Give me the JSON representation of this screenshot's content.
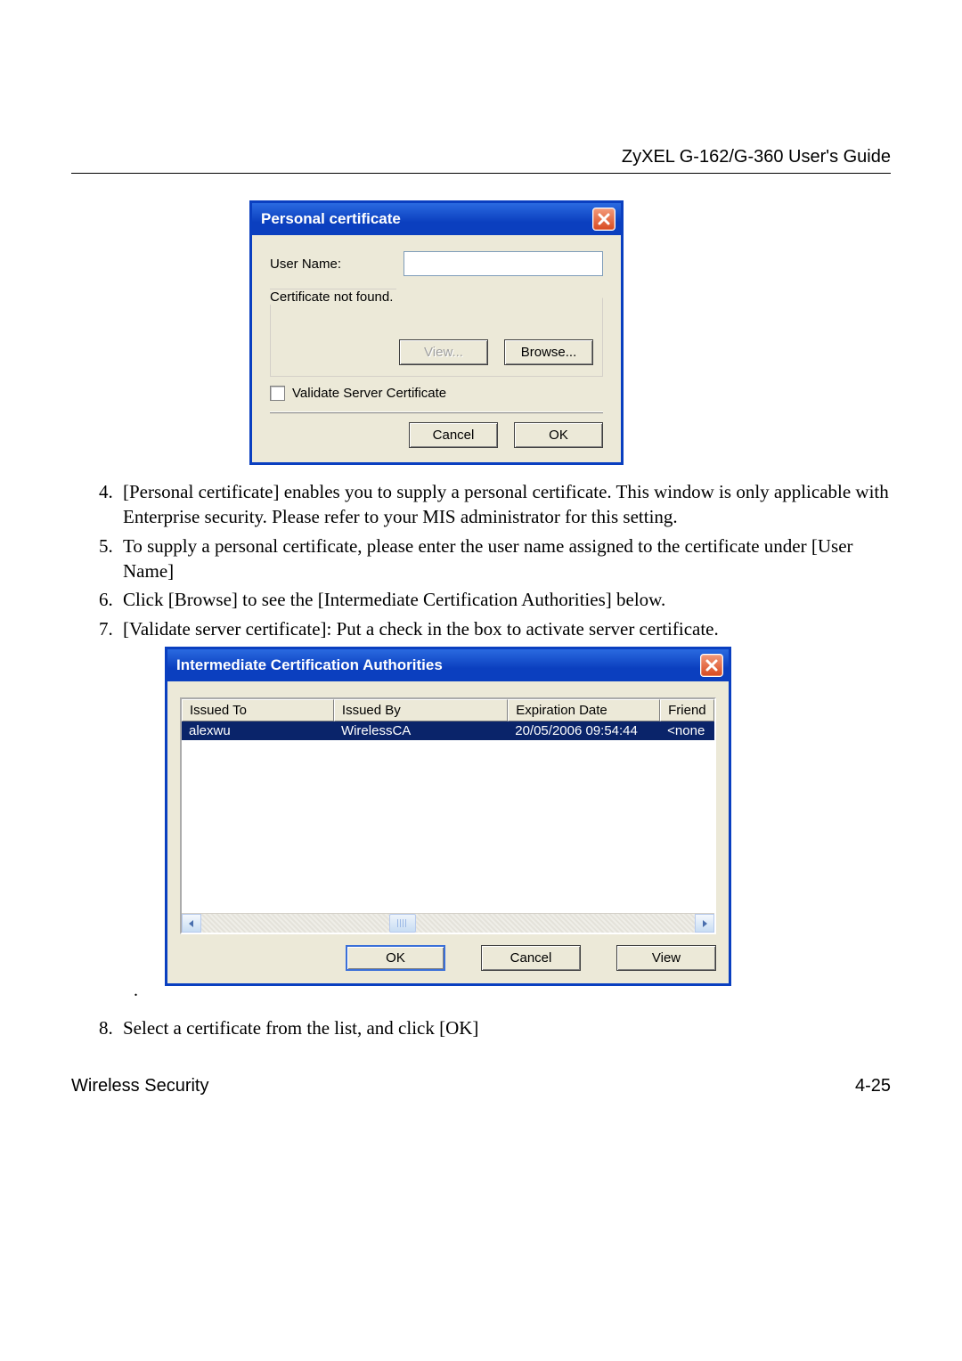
{
  "header": {
    "title": "ZyXEL G-162/G-360 User's Guide"
  },
  "dialog1": {
    "title": "Personal certificate",
    "user_name_label": "User Name:",
    "user_name_value": "",
    "group_caption": "Certificate not found.",
    "view_btn": "View...",
    "browse_btn": "Browse...",
    "validate_label": "Validate Server Certificate",
    "cancel_btn": "Cancel",
    "ok_btn": "OK"
  },
  "list": {
    "items": [
      {
        "n": "4.",
        "t": "[Personal certificate] enables you to supply a personal certificate.  This window is only applicable with Enterprise security.  Please refer to your MIS administrator for this setting."
      },
      {
        "n": "5.",
        "t": "To supply a personal certificate, please enter the user name assigned to the certificate under [User Name]"
      },
      {
        "n": "6.",
        "t": " Click [Browse] to see the [Intermediate Certification Authorities] below."
      },
      {
        "n": "7.",
        "t": " [Validate server certificate]: Put a check in the box to activate server certificate."
      }
    ]
  },
  "dialog2": {
    "title": "Intermediate Certification Authorities",
    "headers": {
      "c1": "Issued To",
      "c2": "Issued By",
      "c3": "Expiration Date",
      "c4": "Friend"
    },
    "rows": [
      {
        "c1": "alexwu",
        "c2": "WirelessCA",
        "c3": "20/05/2006 09:54:44",
        "c4": "<none"
      }
    ],
    "ok_btn": "OK",
    "cancel_btn": "Cancel",
    "view_btn": "View"
  },
  "list2": {
    "items": [
      {
        "n": "8.",
        "t": " Select a certificate from the list, and click [OK]"
      }
    ]
  },
  "footer": {
    "left": "Wireless Security",
    "right": "4-25"
  }
}
